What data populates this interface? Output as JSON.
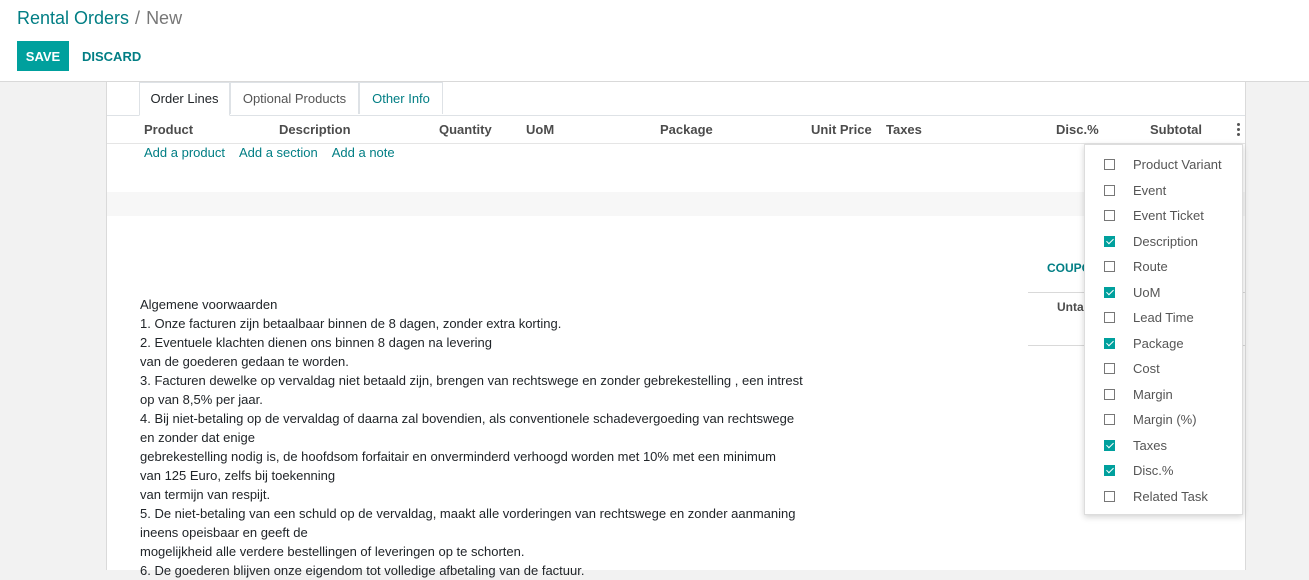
{
  "breadcrumb": {
    "parent": "Rental Orders",
    "separator": "/",
    "current": "New"
  },
  "actions": {
    "save": "SAVE",
    "discard": "DISCARD"
  },
  "tabs": [
    {
      "label": "Order Lines",
      "active": true
    },
    {
      "label": "Optional Products",
      "active": false
    },
    {
      "label": "Other Info",
      "active": false
    }
  ],
  "columns": {
    "product": "Product",
    "description": "Description",
    "quantity": "Quantity",
    "uom": "UoM",
    "package": "Package",
    "unit_price": "Unit Price",
    "taxes": "Taxes",
    "disc": "Disc.%",
    "subtotal": "Subtotal",
    "options_icon": "kebab-menu-icon"
  },
  "add_links": {
    "product": "Add a product",
    "section": "Add a section",
    "note": "Add a note"
  },
  "totals": {
    "coupon": "COUPO",
    "untaxed": "Unta"
  },
  "terms": {
    "lines": [
      "Algemene voorwaarden",
      "1. Onze facturen zijn betaalbaar binnen de 8 dagen, zonder extra korting.",
      "2. Eventuele klachten dienen ons binnen 8 dagen na levering",
      "van de goederen gedaan te worden.",
      "3. Facturen dewelke op vervaldag niet betaald zijn, brengen van rechtswege en zonder gebrekestelling , een intrest",
      "op van 8,5% per jaar.",
      "4. Bij niet-betaling op de vervaldag of daarna zal bovendien, als conventionele schadevergoeding van rechtswege",
      "en zonder dat enige",
      "gebrekestelling nodig is, de hoofdsom forfaitair en onverminderd verhoogd worden met 10% met een minimum",
      "van 125 Euro, zelfs bij toekenning",
      "van termijn van respijt.",
      "5. De niet-betaling van een schuld op de vervaldag, maakt alle vorderingen van rechtswege en zonder aanmaning",
      "ineens opeisbaar en geeft de",
      "mogelijkheid alle verdere bestellingen of leveringen op te schorten.",
      "6. De goederen blijven onze eigendom tot volledige afbetaling van de factuur."
    ]
  },
  "optional_columns": [
    {
      "label": "Product Variant",
      "checked": false
    },
    {
      "label": "Event",
      "checked": false
    },
    {
      "label": "Event Ticket",
      "checked": false
    },
    {
      "label": "Description",
      "checked": true
    },
    {
      "label": "Route",
      "checked": false
    },
    {
      "label": "UoM",
      "checked": true
    },
    {
      "label": "Lead Time",
      "checked": false
    },
    {
      "label": "Package",
      "checked": true
    },
    {
      "label": "Cost",
      "checked": false
    },
    {
      "label": "Margin",
      "checked": false
    },
    {
      "label": "Margin (%)",
      "checked": false
    },
    {
      "label": "Taxes",
      "checked": true
    },
    {
      "label": "Disc.%",
      "checked": true
    },
    {
      "label": "Related Task",
      "checked": false
    }
  ],
  "colors": {
    "primary": "#00a09d",
    "link": "#017e84"
  }
}
